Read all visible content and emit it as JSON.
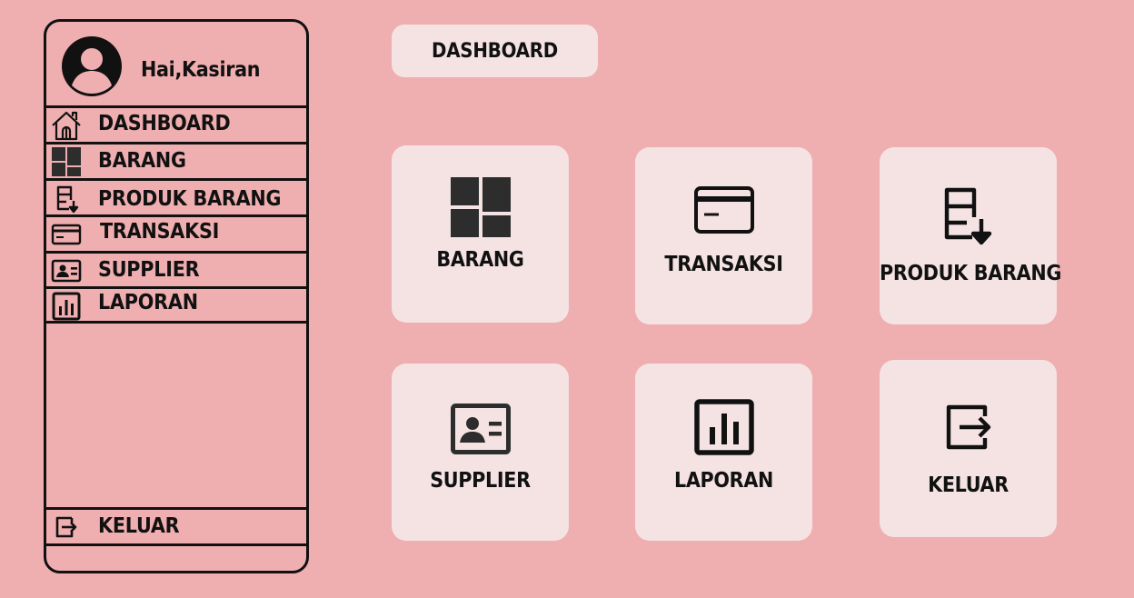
{
  "sidebar": {
    "greeting": "Hai,Kasiran",
    "items": [
      {
        "label": "DASHBOARD",
        "icon": "home-icon"
      },
      {
        "label": "BARANG",
        "icon": "grid-icon"
      },
      {
        "label": "PRODUK BARANG",
        "icon": "product-list-icon"
      },
      {
        "label": "TRANSAKSI",
        "icon": "credit-card-icon"
      },
      {
        "label": "SUPPLIER",
        "icon": "contact-card-icon"
      },
      {
        "label": "LAPORAN",
        "icon": "bar-chart-icon"
      }
    ],
    "logout": {
      "label": "KELUAR",
      "icon": "logout-icon"
    }
  },
  "header": {
    "title": "DASHBOARD"
  },
  "cards": [
    {
      "label": "BARANG",
      "icon": "grid-icon"
    },
    {
      "label": "TRANSAKSI",
      "icon": "credit-card-icon"
    },
    {
      "label": "PRODUK BARANG",
      "icon": "product-list-icon"
    },
    {
      "label": "SUPPLIER",
      "icon": "contact-card-icon"
    },
    {
      "label": "LAPORAN",
      "icon": "bar-chart-icon"
    },
    {
      "label": "KELUAR",
      "icon": "logout-icon"
    }
  ],
  "colors": {
    "background": "#efaeb0",
    "card": "#f5e3e3",
    "ink": "#111111"
  }
}
